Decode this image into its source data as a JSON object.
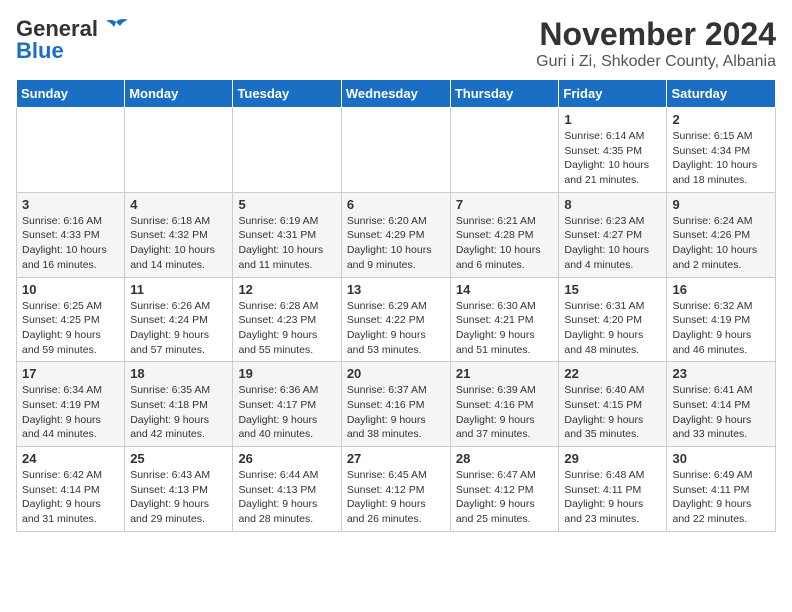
{
  "logo": {
    "text_general": "General",
    "text_blue": "Blue"
  },
  "title": "November 2024",
  "subtitle": "Guri i Zi, Shkoder County, Albania",
  "days_of_week": [
    "Sunday",
    "Monday",
    "Tuesday",
    "Wednesday",
    "Thursday",
    "Friday",
    "Saturday"
  ],
  "weeks": [
    [
      {
        "day": "",
        "detail": ""
      },
      {
        "day": "",
        "detail": ""
      },
      {
        "day": "",
        "detail": ""
      },
      {
        "day": "",
        "detail": ""
      },
      {
        "day": "",
        "detail": ""
      },
      {
        "day": "1",
        "detail": "Sunrise: 6:14 AM\nSunset: 4:35 PM\nDaylight: 10 hours and 21 minutes."
      },
      {
        "day": "2",
        "detail": "Sunrise: 6:15 AM\nSunset: 4:34 PM\nDaylight: 10 hours and 18 minutes."
      }
    ],
    [
      {
        "day": "3",
        "detail": "Sunrise: 6:16 AM\nSunset: 4:33 PM\nDaylight: 10 hours and 16 minutes."
      },
      {
        "day": "4",
        "detail": "Sunrise: 6:18 AM\nSunset: 4:32 PM\nDaylight: 10 hours and 14 minutes."
      },
      {
        "day": "5",
        "detail": "Sunrise: 6:19 AM\nSunset: 4:31 PM\nDaylight: 10 hours and 11 minutes."
      },
      {
        "day": "6",
        "detail": "Sunrise: 6:20 AM\nSunset: 4:29 PM\nDaylight: 10 hours and 9 minutes."
      },
      {
        "day": "7",
        "detail": "Sunrise: 6:21 AM\nSunset: 4:28 PM\nDaylight: 10 hours and 6 minutes."
      },
      {
        "day": "8",
        "detail": "Sunrise: 6:23 AM\nSunset: 4:27 PM\nDaylight: 10 hours and 4 minutes."
      },
      {
        "day": "9",
        "detail": "Sunrise: 6:24 AM\nSunset: 4:26 PM\nDaylight: 10 hours and 2 minutes."
      }
    ],
    [
      {
        "day": "10",
        "detail": "Sunrise: 6:25 AM\nSunset: 4:25 PM\nDaylight: 9 hours and 59 minutes."
      },
      {
        "day": "11",
        "detail": "Sunrise: 6:26 AM\nSunset: 4:24 PM\nDaylight: 9 hours and 57 minutes."
      },
      {
        "day": "12",
        "detail": "Sunrise: 6:28 AM\nSunset: 4:23 PM\nDaylight: 9 hours and 55 minutes."
      },
      {
        "day": "13",
        "detail": "Sunrise: 6:29 AM\nSunset: 4:22 PM\nDaylight: 9 hours and 53 minutes."
      },
      {
        "day": "14",
        "detail": "Sunrise: 6:30 AM\nSunset: 4:21 PM\nDaylight: 9 hours and 51 minutes."
      },
      {
        "day": "15",
        "detail": "Sunrise: 6:31 AM\nSunset: 4:20 PM\nDaylight: 9 hours and 48 minutes."
      },
      {
        "day": "16",
        "detail": "Sunrise: 6:32 AM\nSunset: 4:19 PM\nDaylight: 9 hours and 46 minutes."
      }
    ],
    [
      {
        "day": "17",
        "detail": "Sunrise: 6:34 AM\nSunset: 4:19 PM\nDaylight: 9 hours and 44 minutes."
      },
      {
        "day": "18",
        "detail": "Sunrise: 6:35 AM\nSunset: 4:18 PM\nDaylight: 9 hours and 42 minutes."
      },
      {
        "day": "19",
        "detail": "Sunrise: 6:36 AM\nSunset: 4:17 PM\nDaylight: 9 hours and 40 minutes."
      },
      {
        "day": "20",
        "detail": "Sunrise: 6:37 AM\nSunset: 4:16 PM\nDaylight: 9 hours and 38 minutes."
      },
      {
        "day": "21",
        "detail": "Sunrise: 6:39 AM\nSunset: 4:16 PM\nDaylight: 9 hours and 37 minutes."
      },
      {
        "day": "22",
        "detail": "Sunrise: 6:40 AM\nSunset: 4:15 PM\nDaylight: 9 hours and 35 minutes."
      },
      {
        "day": "23",
        "detail": "Sunrise: 6:41 AM\nSunset: 4:14 PM\nDaylight: 9 hours and 33 minutes."
      }
    ],
    [
      {
        "day": "24",
        "detail": "Sunrise: 6:42 AM\nSunset: 4:14 PM\nDaylight: 9 hours and 31 minutes."
      },
      {
        "day": "25",
        "detail": "Sunrise: 6:43 AM\nSunset: 4:13 PM\nDaylight: 9 hours and 29 minutes."
      },
      {
        "day": "26",
        "detail": "Sunrise: 6:44 AM\nSunset: 4:13 PM\nDaylight: 9 hours and 28 minutes."
      },
      {
        "day": "27",
        "detail": "Sunrise: 6:45 AM\nSunset: 4:12 PM\nDaylight: 9 hours and 26 minutes."
      },
      {
        "day": "28",
        "detail": "Sunrise: 6:47 AM\nSunset: 4:12 PM\nDaylight: 9 hours and 25 minutes."
      },
      {
        "day": "29",
        "detail": "Sunrise: 6:48 AM\nSunset: 4:11 PM\nDaylight: 9 hours and 23 minutes."
      },
      {
        "day": "30",
        "detail": "Sunrise: 6:49 AM\nSunset: 4:11 PM\nDaylight: 9 hours and 22 minutes."
      }
    ]
  ]
}
